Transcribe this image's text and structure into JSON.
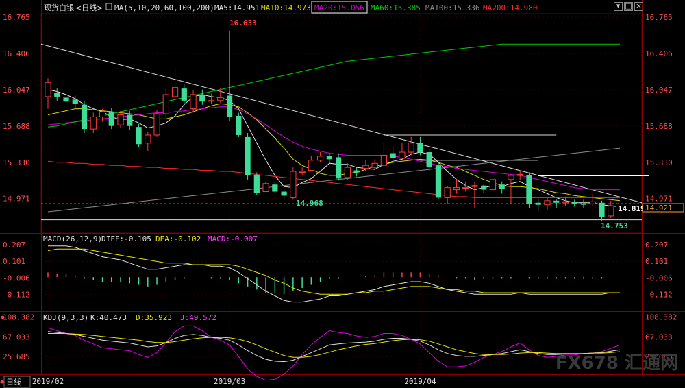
{
  "instrument": "现货白银",
  "period": "<日线>",
  "footer_period": "日线",
  "window_buttons": [
    "restore",
    "maximize",
    "close"
  ],
  "ma_legend": {
    "title": "MA(5,10,20,60,100,200)",
    "items": [
      {
        "label": "MA5:14.951",
        "color": "#e6e6e6"
      },
      {
        "label": "MA10:14.973",
        "color": "#d9d900"
      },
      {
        "label": "MA20:15.056",
        "color": "#d600d6",
        "boxed": true
      },
      {
        "label": "MA60:15.385",
        "color": "#00cc00"
      },
      {
        "label": "MA100:15.336",
        "color": "#8c8c8c"
      },
      {
        "label": "MA200:14.980",
        "color": "#ff2a2a"
      }
    ]
  },
  "macd_legend": {
    "title": "MACD(26,12,9)",
    "diff": "DIFF:-0.105",
    "dea": "DEA:-0.102",
    "macd": "MACD:-0.007"
  },
  "kdj_legend": {
    "title": "KDJ(9,3,3)",
    "k": "K:40.473",
    "d": "D:35.923",
    "j": "J:49.572"
  },
  "annotations": {
    "high": "16.633",
    "low": "14.753",
    "mid_low": "14.968",
    "last_price": "14.819",
    "cursor_price": "14.921"
  },
  "watermark": "FX678 汇通网",
  "chart_data": {
    "type": "candlestick",
    "colors": {
      "up": "#ff3b3b",
      "down": "#3ddc97"
    },
    "price_axis": {
      "ticks": [
        "16.765",
        "16.406",
        "16.047",
        "15.688",
        "15.330",
        "14.971"
      ],
      "ylim": [
        14.63,
        16.8
      ]
    },
    "macd_axis": {
      "ticks": [
        "0.207",
        "0.101",
        "-0.006",
        "-0.112"
      ],
      "ylim": [
        -0.21,
        0.26
      ]
    },
    "kdj_axis": {
      "ticks": [
        "108.382",
        "67.033",
        "25.685"
      ],
      "ylim": [
        -10,
        115
      ]
    },
    "x_labels": [
      {
        "text": "2019/02",
        "index": 0
      },
      {
        "text": "2019/03",
        "index": 20
      },
      {
        "text": "2019/04",
        "index": 41
      }
    ],
    "candles": [
      [
        15.98,
        16.12,
        16.16,
        15.86
      ],
      [
        16.02,
        15.98,
        16.06,
        15.94
      ],
      [
        15.97,
        15.93,
        16.01,
        15.9
      ],
      [
        15.95,
        15.91,
        15.99,
        15.87
      ],
      [
        15.9,
        15.66,
        15.94,
        15.62
      ],
      [
        15.66,
        15.78,
        15.82,
        15.62
      ],
      [
        15.78,
        15.83,
        15.86,
        15.74
      ],
      [
        15.83,
        15.69,
        15.87,
        15.66
      ],
      [
        15.7,
        15.8,
        15.84,
        15.67
      ],
      [
        15.8,
        15.69,
        15.84,
        15.65
      ],
      [
        15.68,
        15.51,
        15.71,
        15.48
      ],
      [
        15.52,
        15.6,
        15.63,
        15.44
      ],
      [
        15.6,
        15.81,
        15.85,
        15.58
      ],
      [
        15.81,
        16.0,
        16.06,
        15.78
      ],
      [
        15.98,
        16.07,
        16.26,
        15.95
      ],
      [
        16.06,
        15.94,
        16.1,
        15.9
      ],
      [
        15.86,
        16.0,
        16.04,
        15.82
      ],
      [
        16.0,
        15.93,
        16.05,
        15.9
      ],
      [
        15.94,
        15.94,
        16.01,
        15.91
      ],
      [
        15.94,
        15.97,
        16.06,
        15.92
      ],
      [
        15.99,
        15.78,
        16.63,
        15.74
      ],
      [
        15.79,
        15.6,
        15.82,
        15.58
      ],
      [
        15.58,
        15.2,
        15.62,
        15.16
      ],
      [
        15.2,
        15.03,
        15.23,
        15.01
      ],
      [
        15.04,
        15.12,
        15.14,
        15.04
      ],
      [
        15.11,
        15.04,
        15.14,
        15.02
      ],
      [
        15.04,
        15.0,
        15.06,
        14.96
      ],
      [
        14.98,
        15.24,
        15.28,
        14.96
      ],
      [
        15.23,
        15.24,
        15.28,
        15.2
      ],
      [
        15.25,
        15.35,
        15.39,
        15.24
      ],
      [
        15.35,
        15.39,
        15.43,
        15.33
      ],
      [
        15.39,
        15.36,
        15.42,
        15.32
      ],
      [
        15.38,
        15.17,
        15.42,
        15.15
      ],
      [
        15.18,
        15.28,
        15.32,
        15.16
      ],
      [
        15.25,
        15.23,
        15.28,
        15.19
      ],
      [
        15.27,
        15.3,
        15.35,
        15.24
      ],
      [
        15.28,
        15.32,
        15.36,
        15.26
      ],
      [
        15.3,
        15.4,
        15.52,
        15.28
      ],
      [
        15.42,
        15.37,
        15.49,
        15.35
      ],
      [
        15.37,
        15.43,
        15.52,
        15.36
      ],
      [
        15.43,
        15.52,
        15.58,
        15.4
      ],
      [
        15.52,
        15.43,
        15.58,
        15.4
      ],
      [
        15.43,
        15.28,
        15.46,
        15.24
      ],
      [
        15.3,
        14.98,
        15.33,
        14.96
      ],
      [
        14.98,
        15.08,
        15.1,
        14.92
      ],
      [
        15.06,
        15.08,
        15.16,
        15.02
      ],
      [
        15.08,
        15.08,
        15.14,
        15.04
      ],
      [
        15.09,
        15.1,
        15.14,
        14.88
      ],
      [
        15.1,
        15.06,
        15.11,
        15.03
      ],
      [
        15.06,
        15.16,
        15.18,
        15.04
      ],
      [
        15.11,
        15.07,
        15.14,
        15.02
      ],
      [
        15.16,
        15.2,
        15.21,
        14.92
      ],
      [
        15.2,
        15.21,
        15.25,
        15.16
      ],
      [
        15.2,
        14.92,
        15.23,
        14.88
      ],
      [
        14.93,
        14.91,
        14.96,
        14.85
      ],
      [
        14.91,
        14.95,
        14.98,
        14.86
      ],
      [
        14.95,
        14.93,
        14.96,
        14.88
      ],
      [
        14.93,
        14.94,
        14.99,
        14.9
      ],
      [
        14.94,
        14.92,
        14.96,
        14.89
      ],
      [
        14.92,
        14.91,
        14.96,
        14.88
      ],
      [
        14.92,
        14.94,
        15.02,
        14.9
      ],
      [
        14.93,
        14.79,
        14.95,
        14.75
      ],
      [
        14.8,
        14.9,
        14.95,
        14.78
      ],
      [
        14.89,
        14.86,
        14.92,
        14.84
      ]
    ],
    "ma_series": [
      {
        "name": "MA5",
        "color": "#e6e6e6",
        "values": [
          16.05,
          16.03,
          16.0,
          15.96,
          15.9,
          15.86,
          15.83,
          15.78,
          15.75,
          15.76,
          15.72,
          15.67,
          15.69,
          15.72,
          15.79,
          15.9,
          15.98,
          16.0,
          15.98,
          15.97,
          15.94,
          15.86,
          15.69,
          15.52,
          15.35,
          15.2,
          15.09,
          15.08,
          15.13,
          15.17,
          15.24,
          15.32,
          15.31,
          15.31,
          15.28,
          15.27,
          15.26,
          15.31,
          15.34,
          15.36,
          15.41,
          15.43,
          15.41,
          15.33,
          15.24,
          15.16,
          15.1,
          15.06,
          15.08,
          15.1,
          15.09,
          15.12,
          15.14,
          15.09,
          15.06,
          15.02,
          14.98,
          14.95,
          14.93,
          14.93,
          14.93,
          14.91,
          14.9,
          14.89
        ]
      },
      {
        "name": "MA10",
        "color": "#d9d900",
        "values": [
          15.8,
          15.82,
          15.84,
          15.86,
          15.86,
          15.85,
          15.84,
          15.83,
          15.82,
          15.81,
          15.8,
          15.78,
          15.76,
          15.76,
          15.78,
          15.8,
          15.83,
          15.86,
          15.89,
          15.91,
          15.9,
          15.88,
          15.82,
          15.75,
          15.66,
          15.57,
          15.47,
          15.36,
          15.3,
          15.26,
          15.22,
          15.2,
          15.2,
          15.22,
          15.23,
          15.26,
          15.29,
          15.31,
          15.33,
          15.34,
          15.35,
          15.36,
          15.35,
          15.33,
          15.3,
          15.28,
          15.24,
          15.2,
          15.16,
          15.13,
          15.1,
          15.09,
          15.09,
          15.08,
          15.07,
          15.05,
          15.03,
          15.02,
          15.0,
          14.99,
          14.98,
          14.97,
          14.96,
          14.95
        ]
      },
      {
        "name": "MA20",
        "color": "#d600d6",
        "values": [
          15.7,
          15.71,
          15.72,
          15.73,
          15.74,
          15.75,
          15.76,
          15.77,
          15.78,
          15.79,
          15.8,
          15.81,
          15.82,
          15.82,
          15.83,
          15.84,
          15.85,
          15.86,
          15.87,
          15.88,
          15.88,
          15.85,
          15.81,
          15.76,
          15.7,
          15.64,
          15.58,
          15.53,
          15.49,
          15.46,
          15.44,
          15.42,
          15.41,
          15.4,
          15.4,
          15.4,
          15.4,
          15.4,
          15.39,
          15.38,
          15.36,
          15.34,
          15.32,
          15.3,
          15.29,
          15.27,
          15.26,
          15.25,
          15.24,
          15.23,
          15.22,
          15.21,
          15.2,
          15.18,
          15.16,
          15.14,
          15.12,
          15.1,
          15.08,
          15.07,
          15.06,
          15.06,
          15.06,
          15.06
        ]
      },
      {
        "name": "MA60",
        "color": "#00cc00",
        "values": [
          15.68,
          15.69,
          15.71,
          15.73,
          15.75,
          15.77,
          15.79,
          15.81,
          15.83,
          15.85,
          15.87,
          15.89,
          15.91,
          15.93,
          15.95,
          15.97,
          15.99,
          16.01,
          16.03,
          16.05,
          16.07,
          16.09,
          16.11,
          16.13,
          16.15,
          16.17,
          16.19,
          16.21,
          16.23,
          16.25,
          16.27,
          16.29,
          16.31,
          16.33,
          16.34,
          16.35,
          16.36,
          16.37,
          16.38,
          16.39,
          16.4,
          16.41,
          16.42,
          16.43,
          16.44,
          16.45,
          16.46,
          16.47,
          16.48,
          16.49,
          16.5,
          16.5,
          16.5,
          16.5,
          16.5,
          16.5,
          16.5,
          16.5,
          16.5,
          16.5,
          16.5,
          16.5,
          16.5,
          16.5
        ]
      },
      {
        "name": "MA100",
        "color": "#8c8c8c",
        "values": [
          14.84,
          14.85,
          14.86,
          14.87,
          14.88,
          14.89,
          14.9,
          14.91,
          14.92,
          14.93,
          14.94,
          14.95,
          14.96,
          14.97,
          14.98,
          14.99,
          15.0,
          15.01,
          15.02,
          15.03,
          15.04,
          15.05,
          15.06,
          15.07,
          15.08,
          15.09,
          15.1,
          15.11,
          15.12,
          15.13,
          15.14,
          15.15,
          15.16,
          15.17,
          15.18,
          15.19,
          15.2,
          15.21,
          15.22,
          15.23,
          15.24,
          15.25,
          15.26,
          15.27,
          15.28,
          15.29,
          15.3,
          15.31,
          15.32,
          15.33,
          15.34,
          15.35,
          15.36,
          15.37,
          15.38,
          15.39,
          15.4,
          15.41,
          15.42,
          15.43,
          15.44,
          15.45,
          15.46,
          15.47
        ]
      },
      {
        "name": "MA200",
        "color": "#ff2a2a",
        "values": [
          15.34,
          15.33,
          15.33,
          15.32,
          15.32,
          15.31,
          15.31,
          15.3,
          15.3,
          15.29,
          15.29,
          15.28,
          15.28,
          15.27,
          15.27,
          15.26,
          15.26,
          15.25,
          15.25,
          15.24,
          15.24,
          15.23,
          15.22,
          15.21,
          15.2,
          15.19,
          15.18,
          15.17,
          15.16,
          15.15,
          15.14,
          15.13,
          15.12,
          15.11,
          15.1,
          15.09,
          15.08,
          15.07,
          15.06,
          15.05,
          15.04,
          15.03,
          15.02,
          15.01,
          15.0,
          14.99,
          14.99,
          14.98,
          14.98,
          14.98,
          14.98,
          14.98,
          14.98,
          14.98,
          14.98,
          14.98,
          14.98,
          14.98,
          14.98,
          14.98,
          14.98,
          14.98,
          14.98,
          14.98
        ]
      }
    ],
    "macd": {
      "diff": [
        0.2,
        0.2,
        0.2,
        0.19,
        0.17,
        0.15,
        0.13,
        0.12,
        0.11,
        0.09,
        0.07,
        0.05,
        0.05,
        0.06,
        0.07,
        0.08,
        0.08,
        0.08,
        0.07,
        0.07,
        0.06,
        0.03,
        -0.01,
        -0.05,
        -0.09,
        -0.12,
        -0.15,
        -0.16,
        -0.16,
        -0.15,
        -0.14,
        -0.12,
        -0.12,
        -0.11,
        -0.1,
        -0.09,
        -0.08,
        -0.06,
        -0.05,
        -0.04,
        -0.03,
        -0.03,
        -0.04,
        -0.06,
        -0.08,
        -0.09,
        -0.1,
        -0.11,
        -0.11,
        -0.11,
        -0.11,
        -0.11,
        -0.1,
        -0.11,
        -0.11,
        -0.11,
        -0.11,
        -0.11,
        -0.11,
        -0.11,
        -0.11,
        -0.11,
        -0.1,
        -0.1
      ],
      "dea": [
        0.17,
        0.18,
        0.18,
        0.18,
        0.18,
        0.17,
        0.16,
        0.15,
        0.14,
        0.13,
        0.12,
        0.11,
        0.1,
        0.09,
        0.09,
        0.09,
        0.08,
        0.08,
        0.08,
        0.08,
        0.08,
        0.07,
        0.05,
        0.03,
        0.01,
        -0.02,
        -0.04,
        -0.07,
        -0.09,
        -0.1,
        -0.11,
        -0.11,
        -0.11,
        -0.11,
        -0.1,
        -0.1,
        -0.09,
        -0.09,
        -0.08,
        -0.07,
        -0.06,
        -0.06,
        -0.06,
        -0.07,
        -0.08,
        -0.08,
        -0.09,
        -0.09,
        -0.1,
        -0.1,
        -0.1,
        -0.1,
        -0.1,
        -0.1,
        -0.1,
        -0.1,
        -0.1,
        -0.1,
        -0.1,
        -0.1,
        -0.1,
        -0.1,
        -0.1,
        -0.1
      ],
      "hist": [
        0.03,
        0.02,
        0.02,
        0.01,
        -0.01,
        -0.02,
        -0.03,
        -0.03,
        -0.03,
        -0.04,
        -0.05,
        -0.06,
        -0.05,
        -0.03,
        -0.02,
        -0.01,
        0.0,
        0.0,
        -0.01,
        -0.01,
        -0.02,
        -0.04,
        -0.06,
        -0.08,
        -0.1,
        -0.1,
        -0.11,
        -0.09,
        -0.07,
        -0.05,
        -0.03,
        -0.01,
        -0.01,
        0.0,
        0.0,
        0.01,
        0.01,
        0.03,
        0.03,
        0.03,
        0.03,
        0.03,
        0.02,
        0.01,
        0.0,
        -0.01,
        -0.01,
        -0.02,
        -0.01,
        -0.01,
        -0.01,
        -0.01,
        0.0,
        -0.01,
        -0.01,
        -0.01,
        -0.01,
        -0.01,
        -0.01,
        -0.01,
        -0.01,
        -0.01,
        0.0,
        0.0
      ]
    },
    "kdj": {
      "k": [
        78,
        76,
        74,
        72,
        68,
        64,
        60,
        58,
        56,
        54,
        50,
        46,
        48,
        55,
        64,
        70,
        72,
        70,
        66,
        64,
        60,
        50,
        38,
        28,
        20,
        16,
        15,
        18,
        26,
        34,
        42,
        50,
        52,
        54,
        55,
        56,
        58,
        62,
        64,
        64,
        62,
        58,
        50,
        40,
        32,
        28,
        26,
        26,
        28,
        30,
        32,
        36,
        40,
        36,
        32,
        30,
        30,
        31,
        31,
        32,
        33,
        34,
        37,
        40
      ],
      "d": [
        74,
        74,
        74,
        73,
        72,
        70,
        68,
        66,
        64,
        62,
        60,
        57,
        55,
        55,
        57,
        60,
        63,
        65,
        66,
        66,
        65,
        62,
        57,
        50,
        42,
        35,
        28,
        24,
        24,
        26,
        30,
        35,
        40,
        44,
        48,
        51,
        53,
        56,
        59,
        61,
        62,
        61,
        58,
        52,
        46,
        40,
        36,
        32,
        30,
        30,
        30,
        31,
        33,
        34,
        34,
        33,
        32,
        32,
        32,
        32,
        33,
        33,
        34,
        36
      ],
      "j": [
        86,
        80,
        74,
        70,
        60,
        52,
        44,
        42,
        40,
        38,
        30,
        24,
        34,
        55,
        78,
        90,
        90,
        80,
        66,
        60,
        50,
        26,
        0,
        -16,
        -24,
        -22,
        -11,
        6,
        30,
        50,
        66,
        80,
        76,
        74,
        69,
        66,
        68,
        74,
        74,
        70,
        62,
        52,
        34,
        16,
        4,
        4,
        6,
        14,
        24,
        30,
        36,
        46,
        54,
        40,
        28,
        24,
        26,
        29,
        29,
        32,
        33,
        36,
        43,
        50
      ]
    }
  }
}
